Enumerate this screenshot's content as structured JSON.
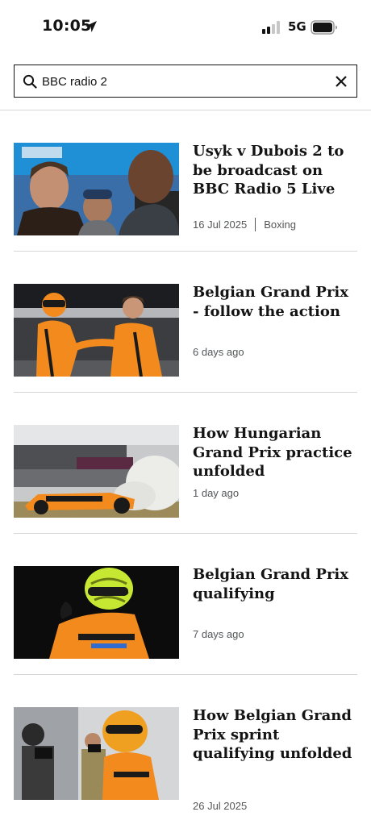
{
  "status_bar": {
    "time": "10:05",
    "network": "5G",
    "icons": [
      "location-arrow-icon",
      "signal-icon",
      "battery-icon"
    ]
  },
  "search": {
    "value": "BBC radio 2",
    "icons": [
      "search-icon",
      "close-icon"
    ]
  },
  "results": [
    {
      "headline": "Usyk v Dubois 2 to be broadcast on BBC Radio 5 Live",
      "time": "16 Jul 2025",
      "topic": "Boxing"
    },
    {
      "headline": "Belgian Grand Prix - follow the action",
      "time": "6 days ago",
      "topic": ""
    },
    {
      "headline": "How Hungarian Grand Prix practice unfolded",
      "time": "1 day ago",
      "topic": ""
    },
    {
      "headline": "Belgian Grand Prix qualifying",
      "time": "7 days ago",
      "topic": ""
    },
    {
      "headline": "How Belgian Grand Prix sprint qualifying unfolded",
      "time": "26 Jul 2025",
      "topic": ""
    }
  ],
  "colors": {
    "text": "#141414",
    "meta": "#545658",
    "divider": "#d6d6d6",
    "mclaren_orange": "#f28a1e"
  }
}
